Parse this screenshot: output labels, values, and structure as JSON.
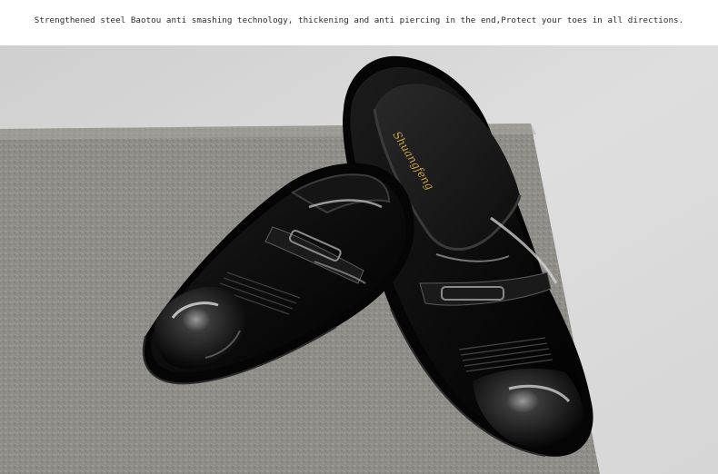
{
  "caption": {
    "text": "Strengthened steel Baotou anti smashing technology, thickening and anti piercing in the end,Protect your toes in all directions."
  },
  "photo": {
    "subject": "pair of black patent leather slip-on shoes with buckle strap on grey carpet",
    "insole_brand_text": "Shuangfeng",
    "colors": {
      "background": "#d9d9d9",
      "carpet": "#8f8d88",
      "shoe": "#0b0b0b"
    }
  }
}
